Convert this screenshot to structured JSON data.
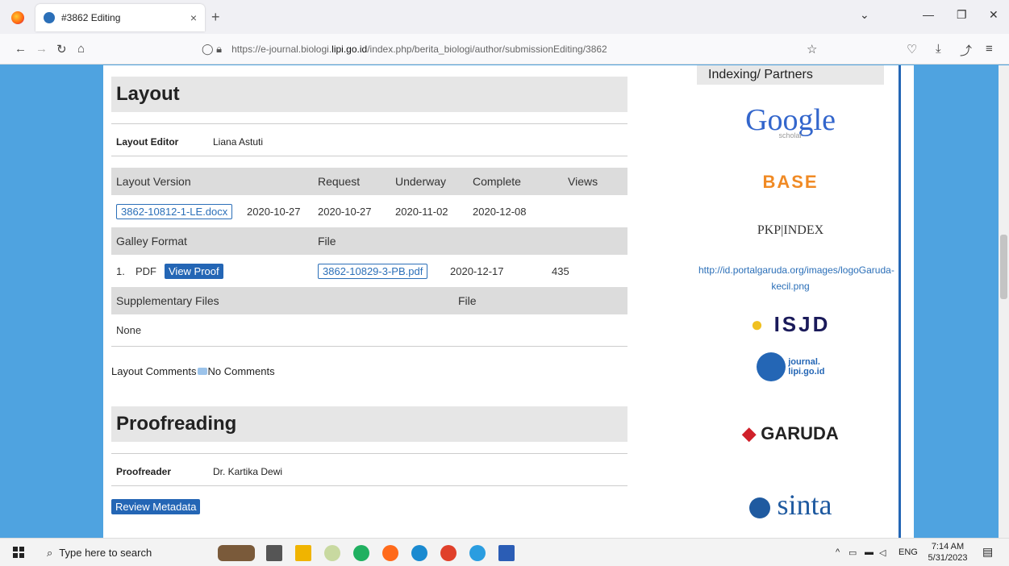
{
  "browser": {
    "tab_title": "#3862 Editing",
    "tab_close": "×",
    "new_tab": "+",
    "url_prefix": "https://e-journal.biologi.",
    "url_domain": "lipi.go.id",
    "url_suffix": "/index.php/berita_biologi/author/submissionEditing/3862"
  },
  "layout": {
    "heading": "Layout",
    "editor_label": "Layout Editor",
    "editor_value": "Liana Astuti",
    "version_headers": [
      "Layout Version",
      "Request",
      "Underway",
      "Complete",
      "Views"
    ],
    "version_row": {
      "file": "3862-10812-1-LE.docx",
      "date": "2020-10-27",
      "request": "2020-10-27",
      "underway": "2020-11-02",
      "complete": "2020-12-08"
    },
    "galley_headers": [
      "Galley Format",
      "File"
    ],
    "galley_row": {
      "num": "1.",
      "format": "PDF",
      "view_proof": "View Proof",
      "file": "3862-10829-3-PB.pdf",
      "date": "2020-12-17",
      "views": "435"
    },
    "supp_headers": [
      "Supplementary Files",
      "File"
    ],
    "supp_value": "None",
    "comments_label": "Layout Comments",
    "comments_value": "No Comments"
  },
  "proofreading": {
    "heading": "Proofreading",
    "proofreader_label": "Proofreader",
    "proofreader_value": "Dr. Kartika Dewi",
    "review_button": "Review Metadata"
  },
  "sidebar": {
    "title": "Indexing/ Partners",
    "google": "Google",
    "google_sub": "scholar",
    "base": "BASE",
    "pkp": "PKP|INDEX",
    "garuda_link": "http://id.portalgaruda.org/images/logoGaruda-kecil.png",
    "isjd": "ISJD",
    "ejournal": "journal.",
    "ejournal_domain": "lipi.go.id",
    "garuda": "GARUDA",
    "sinta": "sinta"
  },
  "taskbar": {
    "search_placeholder": "Type here to search",
    "lang": "ENG",
    "time": "7:14 AM",
    "date": "5/31/2023"
  },
  "colors": {
    "page_bg": "#4fa3e0",
    "accent": "#2466b5",
    "header_bg": "#e6e6e6"
  }
}
